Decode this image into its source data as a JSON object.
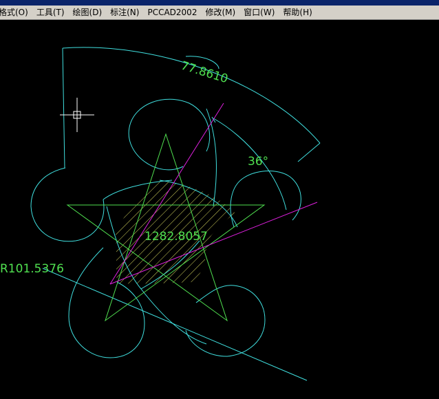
{
  "app": {
    "menu": [
      {
        "id": "format",
        "label": "格式(O)"
      },
      {
        "id": "tools",
        "label": "工具(T)"
      },
      {
        "id": "draw",
        "label": "绘图(D)"
      },
      {
        "id": "dimension",
        "label": "标注(N)"
      },
      {
        "id": "pccad",
        "label": "PCCAD2002"
      },
      {
        "id": "modify",
        "label": "修改(M)"
      },
      {
        "id": "window",
        "label": "窗口(W)"
      },
      {
        "id": "help",
        "label": "帮助(H)"
      }
    ]
  },
  "drawing": {
    "arc_length_dim": "77.8610",
    "angle_dim": "36°",
    "area_label": "1282.8057",
    "radius_dim": "R101.5376",
    "colors": {
      "cyan": "#40e0e0",
      "green": "#50e050",
      "magenta": "#e020e0",
      "yellow": "#d8d860",
      "cursor": "#ffffff"
    }
  }
}
